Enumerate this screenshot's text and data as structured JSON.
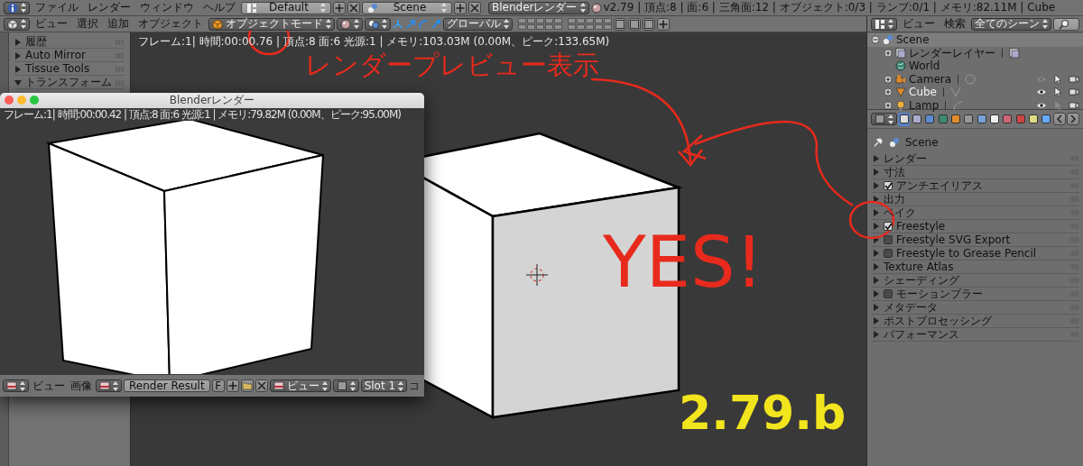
{
  "info_bar": {
    "menus": [
      "ファイル",
      "レンダー",
      "ウィンドウ",
      "ヘルプ"
    ],
    "layout": "Default",
    "scene": "Scene",
    "engine": "Blenderレンダー",
    "stats": "v2.79 | 頂点:8 | 面:6 | 三角面:12 | オブジェクト:0/3 | ランプ:0/1 | メモリ:82.11M | Cube"
  },
  "view_header": {
    "menus": [
      "ビュー",
      "選択",
      "追加",
      "オブジェクト"
    ],
    "mode": "オブジェクトモード",
    "orientation": "グローバル"
  },
  "tool_shelf": {
    "panels": [
      {
        "label": "履歴",
        "expanded": false
      },
      {
        "label": "Auto Mirror",
        "expanded": false
      },
      {
        "label": "Tissue Tools",
        "expanded": false
      },
      {
        "label": "トランスフォーム",
        "expanded": true
      }
    ]
  },
  "viewport": {
    "stats": "フレーム:1| 時間:00:00.76 | 頂点:8 面:6 光源:1 | メモリ:103.03M (0.00M、ピーク:133.65M)"
  },
  "render_window": {
    "title": "Blenderレンダー",
    "stats": "フレーム:1| 時間:00:00.42 | 頂点:8 面:6 光源:1 | メモリ:79.82M (0.00M、ピーク:95.00M)",
    "menus": [
      "ビュー",
      "画像"
    ],
    "image": "Render Result",
    "fake_user": "F",
    "view": "ビュー",
    "slot": "Slot 1",
    "cut_label": "コ"
  },
  "outliner": {
    "menus": [
      "ビュー",
      "検索"
    ],
    "filter": "全てのシーン",
    "tree": [
      {
        "label": "Scene",
        "kind": "scene",
        "expanded": true,
        "children": [
          {
            "label": "レンダーレイヤー",
            "kind": "renderlayer",
            "expanded": false
          },
          {
            "label": "World",
            "kind": "world"
          },
          {
            "label": "Camera",
            "kind": "camera",
            "expanded": false,
            "visible": false,
            "selectable": true
          },
          {
            "label": "Cube",
            "kind": "mesh",
            "expanded": false,
            "visible": true,
            "selectable": true
          },
          {
            "label": "Lamp",
            "kind": "lamp",
            "expanded": false,
            "visible": true,
            "selectable": false
          }
        ]
      }
    ]
  },
  "properties": {
    "context_tabs": [
      {
        "kind": "render",
        "selected": true
      },
      {
        "kind": "layers",
        "selected": false
      },
      {
        "kind": "scene",
        "selected": false
      },
      {
        "kind": "world",
        "selected": false
      },
      {
        "kind": "object",
        "selected": false
      },
      {
        "kind": "constraints",
        "selected": false
      },
      {
        "kind": "modifiers",
        "selected": false
      },
      {
        "kind": "data",
        "selected": false
      },
      {
        "kind": "material",
        "selected": false
      },
      {
        "kind": "texture",
        "selected": false
      },
      {
        "kind": "particles",
        "selected": false
      },
      {
        "kind": "physics",
        "selected": false
      }
    ],
    "context": "Scene",
    "panels": [
      {
        "label": "レンダー",
        "kind": "plain"
      },
      {
        "label": "寸法",
        "kind": "plain"
      },
      {
        "label": "アンチエイリアス",
        "kind": "check",
        "checked": true
      },
      {
        "label": "出力",
        "kind": "plain"
      },
      {
        "label": "ベイク",
        "kind": "plain"
      },
      {
        "label": "Freestyle",
        "kind": "check",
        "checked": true
      },
      {
        "label": "Freestyle SVG Export",
        "kind": "check",
        "checked": false
      },
      {
        "label": "Freestyle to Grease Pencil",
        "kind": "check",
        "checked": false
      },
      {
        "label": "Texture Atlas",
        "kind": "plain"
      },
      {
        "label": "シェーディング",
        "kind": "plain"
      },
      {
        "label": "モーションブラー",
        "kind": "check",
        "checked": false
      },
      {
        "label": "メタデータ",
        "kind": "plain"
      },
      {
        "label": "ポストプロセッシング",
        "kind": "plain"
      },
      {
        "label": "パフォーマンス",
        "kind": "plain"
      }
    ]
  },
  "annotations": [
    {
      "kind": "red",
      "text": "レンダープレビュー表示"
    },
    {
      "kind": "red-big",
      "text": "YES!"
    },
    {
      "kind": "yellow",
      "text": "2.79.b"
    }
  ]
}
